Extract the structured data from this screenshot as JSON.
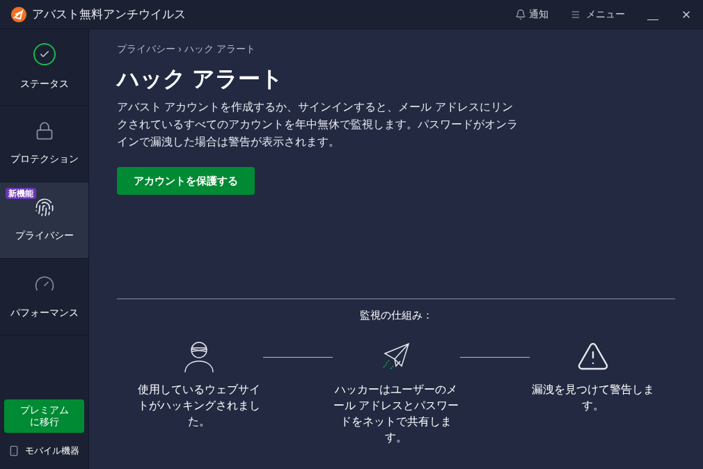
{
  "window": {
    "title": "アバスト無料アンチウイルス",
    "notifications": "通知",
    "menu": "メニュー"
  },
  "sidebar": {
    "items": [
      {
        "kind": "status",
        "label": "ステータス",
        "selected": false
      },
      {
        "kind": "lock",
        "label": "プロテクション",
        "selected": false
      },
      {
        "kind": "fingerprint",
        "label": "プライバシー",
        "selected": true,
        "badge": "新機能"
      },
      {
        "kind": "gauge",
        "label": "パフォーマンス",
        "selected": false
      }
    ],
    "upgrade_button": "プレミアムに移行",
    "mobile": "モバイル機器"
  },
  "breadcrumb": [
    "プライバシー",
    "›",
    "ハック アラート"
  ],
  "title": "ハック アラート",
  "description": "アバスト アカウントを作成するか、サインインすると、メール アドレスにリンクされているすべてのアカウントを年中無休で監視します。パスワードがオンラインで漏洩した場合は警告が表示されます。",
  "primary_button": "アカウントを保護する",
  "how_it_works": {
    "heading": "監視の仕組み：",
    "steps": [
      {
        "kind": "hacker",
        "text": "使用しているウェブサイトがハッキングされました。"
      },
      {
        "kind": "plane",
        "text": "ハッカーはユーザーのメール アドレスとパスワードをネットで共有します。"
      },
      {
        "kind": "warning",
        "text": "漏洩を見つけて警告します。"
      }
    ]
  }
}
